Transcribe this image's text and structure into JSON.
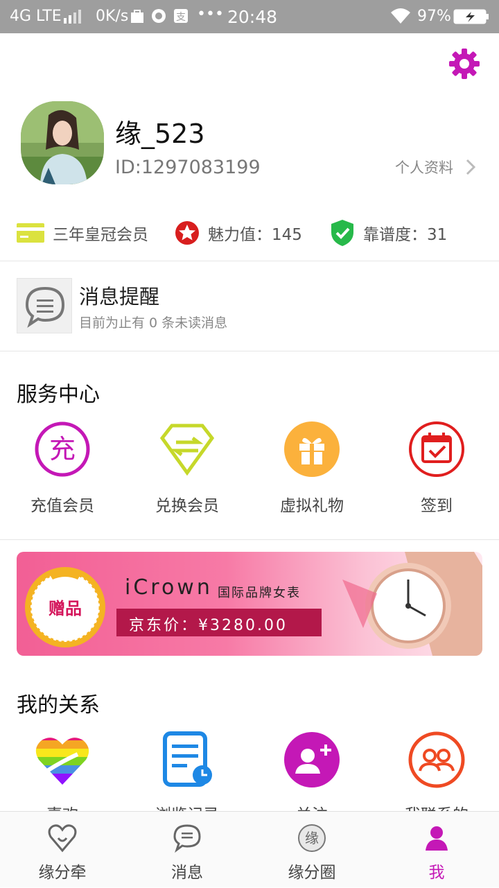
{
  "status_bar": {
    "network": "4G LTE",
    "speed": "0K/s",
    "time": "20:48",
    "battery": "97%",
    "dots": "•••"
  },
  "profile": {
    "username": "缘_523",
    "user_id": "ID:1297083199",
    "profile_link": "个人资料"
  },
  "stats": {
    "membership": "三年皇冠会员",
    "charm": "魅力值：145",
    "reliability": "靠谱度：31"
  },
  "messages": {
    "title": "消息提醒",
    "subtitle": "目前为止有 0 条未读消息"
  },
  "service_center": {
    "title": "服务中心",
    "items": [
      {
        "label": "充值会员",
        "icon": "recharge-icon",
        "glyph": "充"
      },
      {
        "label": "兑换会员",
        "icon": "exchange-icon"
      },
      {
        "label": "虚拟礼物",
        "icon": "gift-icon"
      },
      {
        "label": "签到",
        "icon": "calendar-check-icon"
      }
    ]
  },
  "banner": {
    "badge": "赠品",
    "brand": "iCrown",
    "brand_sub": "国际品牌女表",
    "price": "京东价：¥3280.00"
  },
  "relationships": {
    "title": "我的关系",
    "items": [
      {
        "label": "喜欢",
        "icon": "heart-icon"
      },
      {
        "label": "浏览记录",
        "icon": "history-icon"
      },
      {
        "label": "关注",
        "icon": "follow-icon"
      },
      {
        "label": "我联系的",
        "icon": "contacts-icon"
      }
    ]
  },
  "bottom_nav": {
    "items": [
      {
        "label": "缘分牵",
        "icon": "match-icon"
      },
      {
        "label": "消息",
        "icon": "message-icon"
      },
      {
        "label": "缘分圈",
        "icon": "circle-icon",
        "glyph": "缘"
      },
      {
        "label": "我",
        "icon": "profile-icon",
        "active": true
      }
    ]
  },
  "colors": {
    "accent": "#c418b6",
    "status_bar": "#9e9e9e"
  }
}
